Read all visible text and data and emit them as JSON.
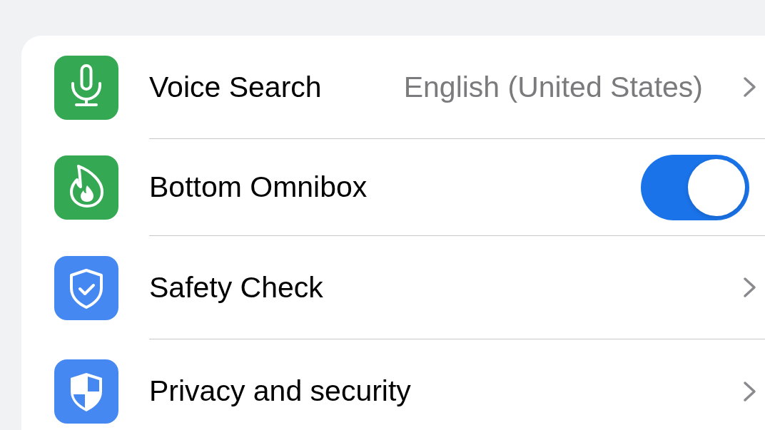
{
  "settings": [
    {
      "kind": "link",
      "label": "Voice Search",
      "value": "English (United States)",
      "color": "#34a853"
    },
    {
      "kind": "toggle",
      "label": "Bottom Omnibox",
      "on": true,
      "color": "#34a853"
    },
    {
      "kind": "link",
      "label": "Safety Check",
      "color": "#4688f1"
    },
    {
      "kind": "link",
      "label": "Privacy and security",
      "color": "#4688f1"
    }
  ]
}
